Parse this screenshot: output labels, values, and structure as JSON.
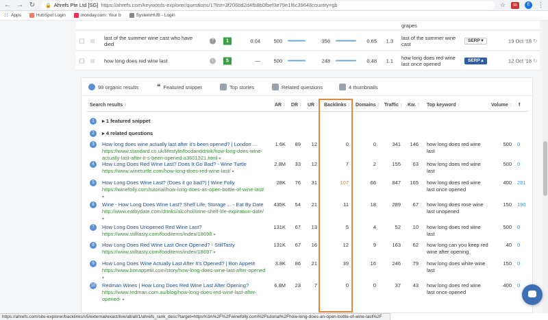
{
  "browser": {
    "site_name": "Ahrefs Pte Ltd [SG]",
    "url": "https://ahrefs.com/keywords-explorer/questions/1?list=3f206bd2d4fb8b0fbef3e79e1f6c39648country=gb",
    "bookmarks": [
      "Apps",
      "HubSpot Login",
      "monday.com: Your b",
      "SystemHUB - Login"
    ],
    "ext_badge": "99",
    "profile_initial": "E"
  },
  "keyword_rows": [
    {
      "parent_top": "grapes"
    },
    {
      "keyword": "last of the summer wine cast who have died",
      "position": "1",
      "kd": "0.04",
      "volume": "500",
      "clicks": "356",
      "cpc": "0.65",
      "ps": "1.3",
      "parent": "last of the summer wine cast",
      "serp": "SERP ▾",
      "updated": "19 Oct '18"
    },
    {
      "keyword": "how long does red wine last",
      "position": "5",
      "kd": "—",
      "volume": "500",
      "clicks": "248",
      "cpc": "0.48",
      "ps": "1.1",
      "parent": "how long does red wine last once opened",
      "serp": "SERP ▴",
      "updated": "12 Oct '18"
    }
  ],
  "serp_tabs": [
    {
      "label": "99 organic results",
      "icon": "globe-icon"
    },
    {
      "label": "Featured snippet",
      "icon": "quote-icon"
    },
    {
      "label": "Top stories",
      "icon": "newspaper-icon"
    },
    {
      "label": "Related questions",
      "icon": "question-icon"
    },
    {
      "label": "4 thumbnails",
      "icon": "image-icon"
    }
  ],
  "columns": {
    "results": "Search results",
    "ar": "AR",
    "dr": "DR",
    "ur": "UR",
    "backlinks": "Backlinks",
    "domains": "Domains",
    "traffic": "Traffic",
    "kw": "Kw.",
    "top_keyword": "Top keyword",
    "volume": "Volume",
    "f": "f",
    "sort": "↕"
  },
  "groups": [
    {
      "num": "1",
      "label": "▸ 1 featured snippet"
    },
    {
      "num": "2",
      "label": "▸ 4 related questions"
    }
  ],
  "results": [
    {
      "num": "3",
      "title": "How long does wine actually last after it's been opened? | London ...",
      "url": "https://www.standard.co.uk/lifestyle/foodanddrink/how-long-does-wine-actually-last-after-it-s-been-opened-a3601321.html",
      "ar": "1.6K",
      "dr": "89",
      "ur": "12",
      "backlinks": "0",
      "domains": "0",
      "traffic": "341",
      "kw": "146",
      "top": "how long does red wine last",
      "vol": "500",
      "f": "0"
    },
    {
      "num": "4",
      "title": "How Long Does Red Wine Last? Does It Go Bad? - Wine Turtle",
      "url": "https://www.wineturtle.com/how-long-does-red-wine-last/",
      "ar": "2.8M",
      "dr": "33",
      "ur": "12",
      "backlinks": "7",
      "domains": "2",
      "traffic": "155",
      "kw": "63",
      "top": "how long does red wine last",
      "vol": "500",
      "f": "0"
    },
    {
      "num": "5",
      "title": "How Long Does Wine Last? (Does it go bad?) | Wine Folly",
      "url": "https://winefolly.com/tutorial/how-long-does-an-open-bottle-of-wine-last/",
      "ar": "28K",
      "dr": "76",
      "ur": "31",
      "backlinks": "107",
      "domains": "66",
      "traffic": "847",
      "kw": "165",
      "top": "how long does red wine last once opened",
      "vol": "400",
      "f": "281"
    },
    {
      "num": "6",
      "title": "Wine - How Long Does Wine Last? Shelf Life, Storage ... - Eat By Date",
      "url": "http://www.eatbydate.com/drinks/alcohol/wine-shelf-life-expiration-date/",
      "ar": "435K",
      "dr": "54",
      "ur": "21",
      "backlinks": "11",
      "domains": "18",
      "traffic": "289",
      "kw": "67",
      "top": "how long does rose wine last unopened",
      "vol": "150",
      "f": "190"
    },
    {
      "num": "7",
      "title": "How Long Does Unopened Red Wine Last?",
      "url": "https://www.stilltasty.com/fooditems/index/18698",
      "ar": "131K",
      "dr": "67",
      "ur": "13",
      "backlinks": "5",
      "domains": "4",
      "traffic": "52",
      "kw": "10",
      "top": "how long does red wine last",
      "vol": "500",
      "f": "0"
    },
    {
      "num": "8",
      "title": "How Long Does Red Wine Last Once Opened? - StillTasty",
      "url": "https://www.stilltasty.com/fooditems/index/18697",
      "ar": "131K",
      "dr": "67",
      "ur": "16",
      "backlinks": "12",
      "domains": "9",
      "traffic": "163",
      "kw": "62",
      "top": "how long can you keep red wine after opening",
      "vol": "40",
      "f": "0"
    },
    {
      "num": "9",
      "title": "How Long Does Wine Actually Last After It's Opened? | Bon Appetit",
      "url": "https://www.bonappetit.com/story/how-long-does-wine-last-after-opened",
      "ar": "3.8K",
      "dr": "86",
      "ur": "21",
      "backlinks": "39",
      "domains": "16",
      "traffic": "246",
      "kw": "79",
      "top": "how long does white wine last",
      "vol": "150",
      "f": "0"
    },
    {
      "num": "10",
      "title": "Redman Wines | How Long Does Red Wine Last After Opening?",
      "url": "https://www.redman.com.au/blog/how-long-does-red-wine-last-after-opened-",
      "ar": "6.8M",
      "dr": "23",
      "ur": "7",
      "backlinks": "0",
      "domains": "0",
      "traffic": "37",
      "kw": "43",
      "top": "how long does red wine last once opened",
      "vol": "400",
      "f": "0"
    }
  ],
  "status_url": "https://ahrefs.com/site-explorer/backlinks/v5/external/exact/live/all/all/1/ahrefs_rank_desc?target=https%3A%2F%2Fwinefolly.com%2Ftutorial%2Fhow-long-does-an-open-bottle-of-wine-last%2F"
}
